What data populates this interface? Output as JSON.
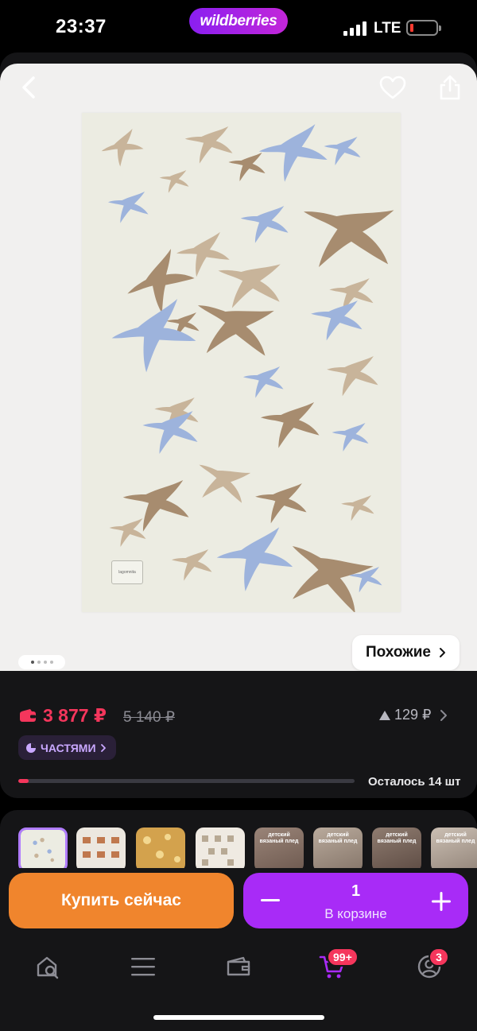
{
  "status_bar": {
    "time": "23:37",
    "brand": "wildberries",
    "network": "LTE",
    "battery_level": "low",
    "battery_color": "#ff3b30"
  },
  "product_image": {
    "similar_label": "Похожие",
    "image_count": 4,
    "current_image": 1,
    "tag_text": "lagomnita",
    "icons": {
      "back": "chevron-left-icon",
      "favorite": "heart-icon",
      "share": "share-icon"
    }
  },
  "price": {
    "current": "3 877 ₽",
    "old": "5 140 ₽",
    "points": "129 ₽",
    "installments_label": "ЧАСТЯМИ",
    "stock_text": "Осталось 14 шт",
    "stock_fraction": 0.03,
    "accent_color": "#f5365c"
  },
  "variants": [
    {
      "caption": "",
      "selected": true
    },
    {
      "caption": "",
      "selected": false
    },
    {
      "caption": "",
      "selected": false
    },
    {
      "caption": "",
      "selected": false
    },
    {
      "caption": "детский вязаный плед",
      "selected": false
    },
    {
      "caption": "детский вязаный плед",
      "selected": false
    },
    {
      "caption": "детский вязаный плед",
      "selected": false
    },
    {
      "caption": "детский вязаный плед",
      "selected": false
    }
  ],
  "actions": {
    "buy_now": "Купить сейчас",
    "cart_quantity": "1",
    "cart_label": "В корзине",
    "buy_color": "#f0852d",
    "cart_color": "#a82bf7"
  },
  "bottom_nav": {
    "items": [
      {
        "name": "home-search",
        "icon": "home-search-icon"
      },
      {
        "name": "catalog",
        "icon": "menu-icon"
      },
      {
        "name": "wallet",
        "icon": "wallet-icon"
      },
      {
        "name": "cart",
        "icon": "cart-icon",
        "badge": "99+"
      },
      {
        "name": "profile",
        "icon": "profile-icon",
        "badge": "3"
      }
    ]
  }
}
